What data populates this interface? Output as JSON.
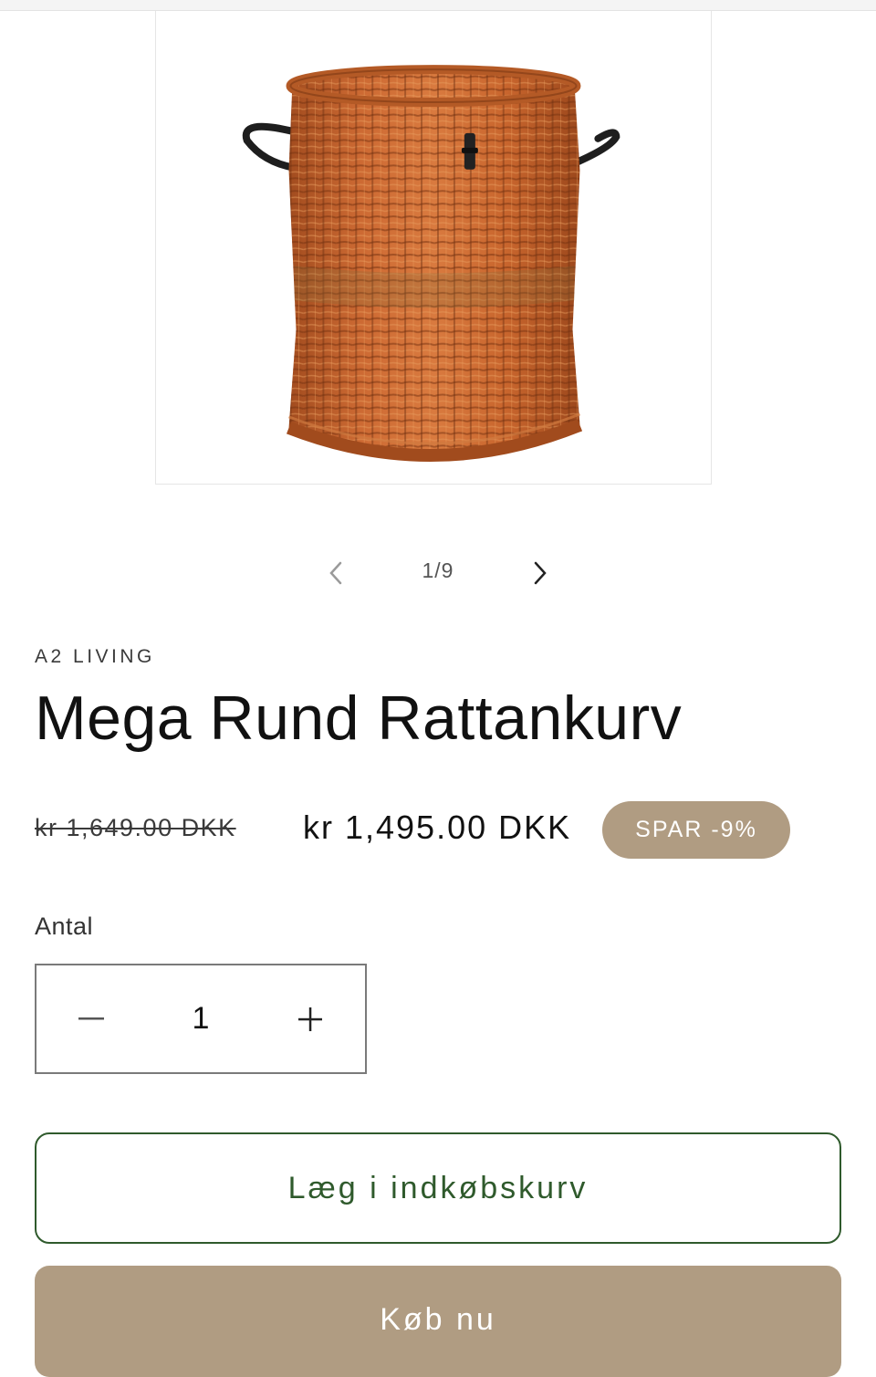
{
  "gallery": {
    "image_alt": "Mega Rund Rattankurv",
    "counter": "1/9",
    "prev_icon": "chevron-left-icon",
    "next_icon": "chevron-right-icon"
  },
  "product": {
    "vendor": "A2 LIVING",
    "title": "Mega Rund Rattankurv",
    "price_original": "kr 1,649.00 DKK",
    "price_sale": "kr 1,495.00 DKK",
    "badge": "SPAR -9%"
  },
  "quantity": {
    "label": "Antal",
    "value": "1",
    "minus_icon": "minus-icon",
    "plus_icon": "plus-icon"
  },
  "actions": {
    "add_to_cart": "Læg i indkøbskurv",
    "buy_now": "Køb nu"
  },
  "colors": {
    "accent": "#b09c82",
    "cart_border": "#2f5a2c",
    "text": "#111111"
  }
}
